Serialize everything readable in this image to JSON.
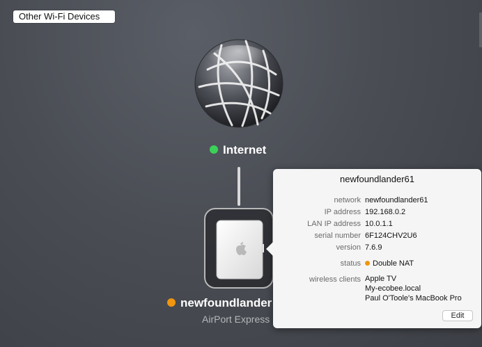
{
  "filter": {
    "label": "Other Wi-Fi Devices"
  },
  "internet": {
    "label": "Internet",
    "status_color": "#3bd159"
  },
  "device": {
    "name": "newfoundlander",
    "type": "AirPort Express",
    "status_color": "#f0960f"
  },
  "popover": {
    "title": "newfoundlander61",
    "rows": [
      {
        "key": "network",
        "value": "newfoundlander61"
      },
      {
        "key": "IP address",
        "value": "192.168.0.2"
      },
      {
        "key": "LAN IP address",
        "value": "10.0.1.1"
      },
      {
        "key": "serial number",
        "value": "6F124CHV2U6"
      },
      {
        "key": "version",
        "value": "7.6.9"
      }
    ],
    "status": {
      "key": "status",
      "value": "Double NAT",
      "color": "#f0960f"
    },
    "wireless_clients": {
      "key": "wireless clients",
      "values": [
        "Apple TV",
        "My-ecobee.local",
        "Paul O'Toole's MacBook Pro"
      ]
    },
    "edit_label": "Edit"
  }
}
